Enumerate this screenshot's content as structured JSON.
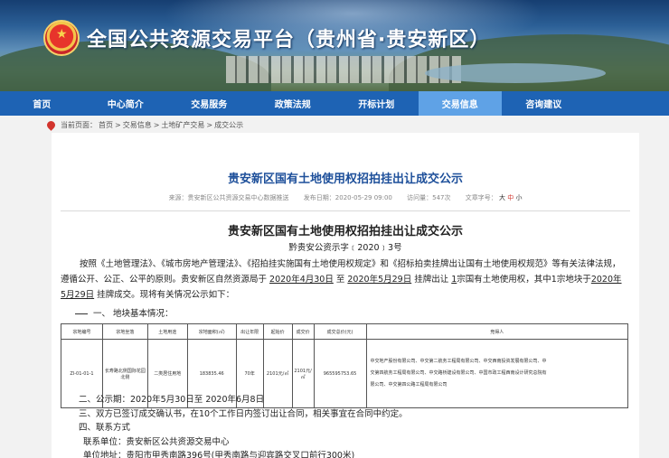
{
  "site": {
    "title": "全国公共资源交易平台（贵州省·贵安新区）"
  },
  "nav": {
    "items": [
      {
        "label": "首页",
        "active": false
      },
      {
        "label": "中心简介",
        "active": false
      },
      {
        "label": "交易服务",
        "active": false
      },
      {
        "label": "政策法规",
        "active": false
      },
      {
        "label": "开标计划",
        "active": false
      },
      {
        "label": "交易信息",
        "active": true
      },
      {
        "label": "咨询建议",
        "active": false
      }
    ]
  },
  "breadcrumb": {
    "prefix": "当前页面：",
    "items": [
      "首页",
      "交易信息",
      "土地矿产交易",
      "成交公示"
    ],
    "separator": " > "
  },
  "article": {
    "page_title": "贵安新区国有土地使用权招拍挂出让成交公示",
    "meta": {
      "source": "来源：贵安新区公共资源交易中心数据推送",
      "published": "发布日期：2020-05-29 09:00",
      "views": "访问量：547次",
      "font_label": "文章字号：",
      "font_large": "大",
      "font_medium": "中",
      "font_small": "小"
    },
    "title": "贵安新区国有土地使用权招拍挂出让成交公示",
    "doc_no": "黔贵安公资示字﹝2020﹞3号",
    "para": {
      "t1": "按照《土地管理法》、《城市房地产管理法》、《招拍挂实施国有土地使用权规定》和《招标拍卖挂牌出让国有土地使用权规范》等有关法律法规，遵循公开、公正、公平的原则。贵安新区自然资源局于 ",
      "d1": "2020年4月30日",
      "t2": " 至 ",
      "d2": "2020年5月29日",
      "t3": " 挂牌出让 ",
      "n1": "1",
      "t4": "宗国有土地使用权，其中1宗地块于",
      "d3": "2020年5月29日",
      "t5": " 挂牌成交。现将有关情况公示如下："
    },
    "section1": "一、  地块基本情况：",
    "table": {
      "headers": [
        "宗地编号",
        "宗地坐落",
        "土地用途",
        "宗地面积(㎡)",
        "出让年限",
        "起始价",
        "成交价",
        "成交总价(元)",
        "竞得人"
      ],
      "rows": [
        {
          "id": "ZI-01-01-1",
          "location": "长寿路北侧国际花园北侧",
          "use": "二类居住用地",
          "area": "183835.46",
          "term": "70年",
          "start_price": "2101元/㎡",
          "deal_price": "2101元/㎡",
          "total": "965595753.65",
          "bidder_lines": [
            "中交地产股份有限公司、中交第二航务工程局有限公司、中交西南投资发展有限公司、中",
            "交第四航务工程局有限公司、中交路桥建设有限公司、中国市政工程西南设计研究总院有",
            "限公司、中交第四公路工程局有限公司"
          ]
        }
      ]
    },
    "section2": "二、公示期：2020年5月30日至 2020年6月8日",
    "section3": "三、双方已签订成交确认书，在10个工作日内签订出让合同，相关事宜在合同中约定。",
    "section4": "四、联系方式",
    "contact_unit": "联系单位：贵安新区公共资源交易中心",
    "contact_addr": "单位地址：贵阳市甲秀南路396号(甲秀南路与迎宾路交叉口前行300米)"
  }
}
